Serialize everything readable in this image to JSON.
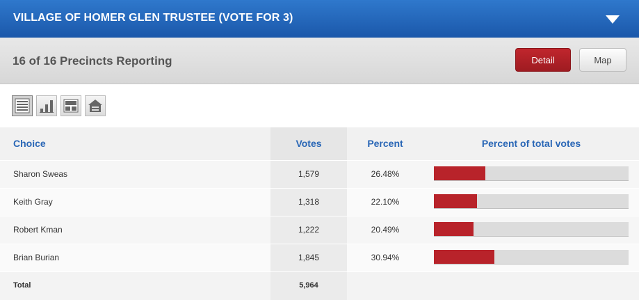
{
  "header": {
    "title": "VILLAGE OF HOMER GLEN TRUSTEE (VOTE FOR 3)",
    "toggle_icon": "chevron-down-icon"
  },
  "status": {
    "reporting": "16 of 16 Precincts Reporting",
    "detail_label": "Detail",
    "map_label": "Map",
    "accent": "#b8232a"
  },
  "views": [
    "table-view-icon",
    "bar-chart-view-icon",
    "grid-view-icon",
    "home-view-icon"
  ],
  "table": {
    "columns": {
      "choice": "Choice",
      "votes": "Votes",
      "percent": "Percent",
      "share": "Percent of total votes"
    },
    "rows": [
      {
        "choice": "Sharon Sweas",
        "votes": "1,579",
        "percent": "26.48%",
        "share": 26.48
      },
      {
        "choice": "Keith Gray",
        "votes": "1,318",
        "percent": "22.10%",
        "share": 22.1
      },
      {
        "choice": "Robert Kman",
        "votes": "1,222",
        "percent": "20.49%",
        "share": 20.49
      },
      {
        "choice": "Brian Burian",
        "votes": "1,845",
        "percent": "30.94%",
        "share": 30.94
      }
    ],
    "total_label": "Total",
    "total_votes": "5,964"
  }
}
